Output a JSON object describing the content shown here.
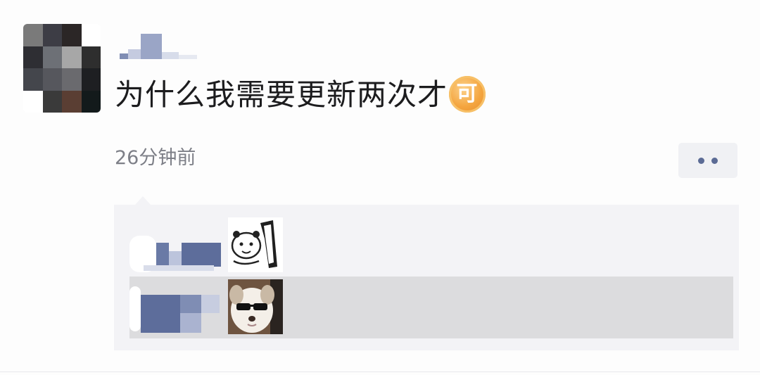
{
  "post": {
    "text": "为什么我需要更新两次才",
    "emoji_label": "可",
    "timestamp": "26分钟前"
  },
  "icons": {
    "more": "more-dots-icon",
    "emoji": "ke-emoji-icon",
    "sticker1": "panda-meme-sticker",
    "sticker2": "sunglasses-dog-sticker"
  },
  "colors": {
    "link_blue": "#5b6b95",
    "text": "#1c1c1e",
    "muted": "#7d7f87",
    "comment_bg": "#f3f3f6",
    "emoji_orange": "#f4a53f"
  }
}
